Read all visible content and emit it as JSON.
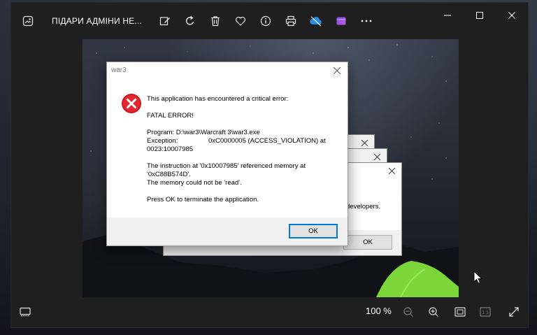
{
  "app": {
    "title": "ПІДАРИ АДМІНИ НЕ...",
    "toolbar": [
      "edit-icon",
      "rotate-icon",
      "delete-icon",
      "favorite-icon",
      "info-icon",
      "print-icon",
      "cloud-icon",
      "clipchamp-icon",
      "more-icon"
    ]
  },
  "dialog_main": {
    "title": "war3",
    "line1": "This application has encountered a critical error:",
    "line2": "FATAL ERROR!",
    "program": "Program: D:\\war3\\Warcraft 3\\war3.exe",
    "exception_label": "Exception:",
    "exception_value": "0xC0000005 (ACCESS_VIOLATION) at",
    "exception_addr": "0023:10007985",
    "instr1": "The instruction at '0x10007985' referenced memory at",
    "instr2": "'0xC88B574D'.",
    "instr3": "The memory could not be 'read'.",
    "press": "Press OK to terminate the application.",
    "ok_label": "OK"
  },
  "dialog_back": {
    "text": "developers.",
    "ok_label": "OK"
  },
  "bottombar": {
    "zoom": "100 %"
  },
  "colors": {
    "window_bg": "#1f1f1f",
    "error_red": "#d8202a",
    "focus_blue": "#0078d7",
    "tent_green": "#7cd63a"
  }
}
